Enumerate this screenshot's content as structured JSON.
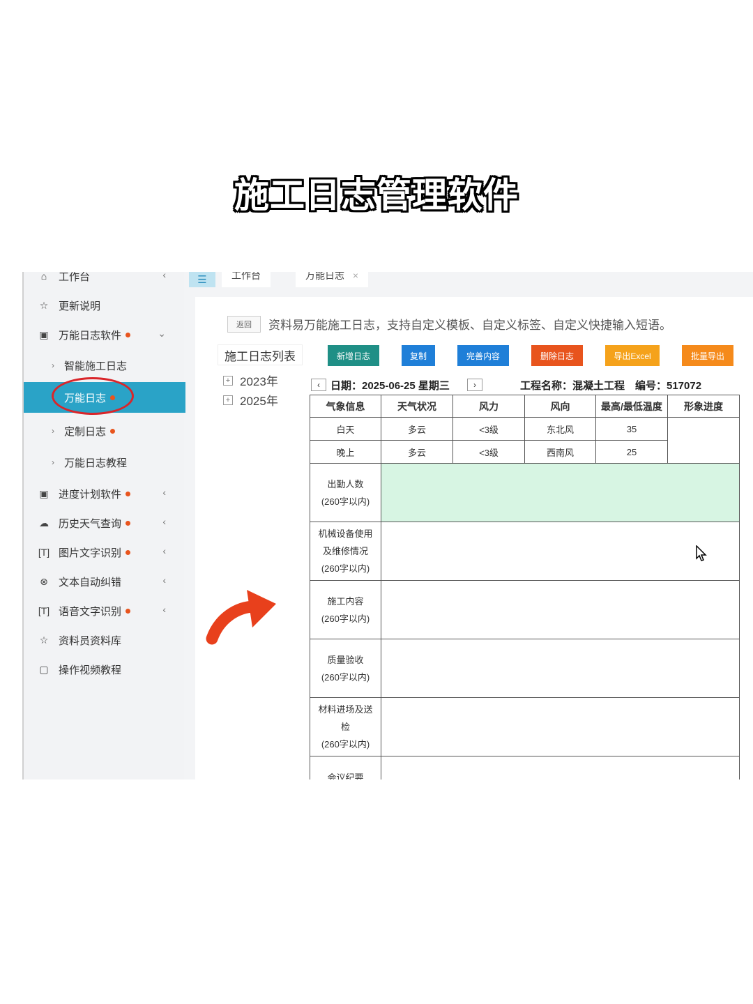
{
  "banner": {
    "title": "施工日志管理软件"
  },
  "sidebar": {
    "items": [
      {
        "label": "工作台",
        "icon": "home-icon"
      },
      {
        "label": "更新说明",
        "icon": "star-icon"
      },
      {
        "label": "万能日志软件",
        "icon": "image-icon"
      },
      {
        "label": "智能施工日志"
      },
      {
        "label": "万能日志"
      },
      {
        "label": "定制日志"
      },
      {
        "label": "万能日志教程"
      },
      {
        "label": "进度计划软件",
        "icon": "image-icon"
      },
      {
        "label": "历史天气查询",
        "icon": "weather-icon"
      },
      {
        "label": "图片文字识别",
        "icon": "text-scan-icon"
      },
      {
        "label": "文本自动纠错",
        "icon": "check-circle-icon"
      },
      {
        "label": "语音文字识别",
        "icon": "text-scan-icon"
      },
      {
        "label": "资料员资料库",
        "icon": "star-icon"
      },
      {
        "label": "操作视频教程",
        "icon": "video-icon"
      }
    ]
  },
  "tabs": [
    {
      "label": "工作台"
    },
    {
      "label": "万能日志"
    }
  ],
  "panel": {
    "back_label": "返回",
    "notice": "资料易万能施工日志，支持自定义模板、自定义标签、自定义快捷输入短语。",
    "list_title": "施工日志列表",
    "toolbar": [
      {
        "label": "新增日志",
        "color": "#1f8f86"
      },
      {
        "label": "复制",
        "color": "#1f7fd8"
      },
      {
        "label": "完善内容",
        "color": "#1f7fd8"
      },
      {
        "label": "删除日志",
        "color": "#e8541d"
      },
      {
        "label": "导出Excel",
        "color": "#f5a21b"
      },
      {
        "label": "批量导出",
        "color": "#f58a1b"
      }
    ],
    "tree": [
      {
        "label": "2023年"
      },
      {
        "label": "2025年"
      }
    ],
    "date_line": "日期：2025-06-25 星期三",
    "project_line": "工程名称：混凝土工程　编号：517072",
    "weather_headers": [
      "气象信息",
      "天气状况",
      "风力",
      "风向",
      "最高/最低温度",
      "形象进度"
    ],
    "weather_rows": [
      {
        "period": "白天",
        "condition": "多云",
        "wind_force": "<3级",
        "wind_dir": "东北风",
        "temp": "35"
      },
      {
        "period": "晚上",
        "condition": "多云",
        "wind_force": "<3级",
        "wind_dir": "西南风",
        "temp": "25"
      }
    ],
    "sections": [
      {
        "line1": "出勤人数",
        "line2": "",
        "limit": "(260字以内)"
      },
      {
        "line1": "机械设备使用",
        "line2": "及维修情况",
        "limit": "(260字以内)"
      },
      {
        "line1": "施工内容",
        "line2": "",
        "limit": "(260字以内)"
      },
      {
        "line1": "质量验收",
        "line2": "",
        "limit": "(260字以内)"
      },
      {
        "line1": "材料进场及送",
        "line2": "检",
        "limit": "(260字以内)"
      },
      {
        "line1": "会议纪要",
        "line2": "",
        "limit": ""
      }
    ]
  }
}
